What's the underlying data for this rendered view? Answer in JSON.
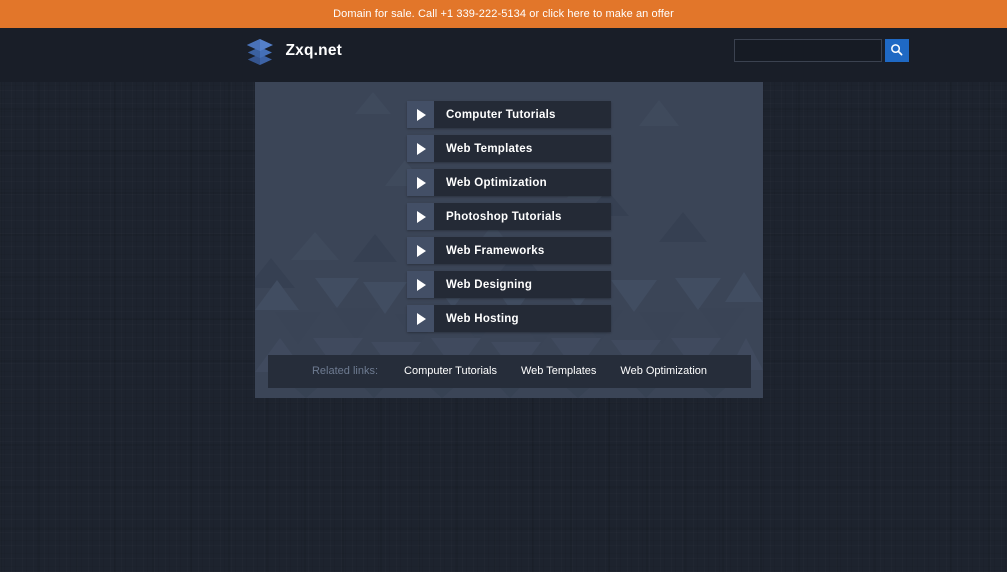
{
  "domain_bar": {
    "text": "Domain for sale. Call +1 339-222-5134 or click here to make an offer"
  },
  "header": {
    "brand_name": "Zxq.net",
    "logo_icon": "layers-stack-icon",
    "search": {
      "value": "",
      "placeholder": "",
      "button_icon": "search-icon"
    }
  },
  "main": {
    "menu_items": [
      {
        "label": "Computer Tutorials"
      },
      {
        "label": "Web Templates"
      },
      {
        "label": "Web Optimization"
      },
      {
        "label": "Photoshop Tutorials"
      },
      {
        "label": "Web Frameworks"
      },
      {
        "label": "Web Designing"
      },
      {
        "label": "Web Hosting"
      }
    ],
    "related": {
      "label": "Related links:",
      "links": [
        {
          "label": "Computer Tutorials"
        },
        {
          "label": "Web Templates"
        },
        {
          "label": "Web Optimization"
        }
      ]
    }
  },
  "colors": {
    "domain_bar_bg": "#e2762a",
    "header_bg": "#191e28",
    "page_bg": "#1d232e",
    "panel_bg": "#3b4557",
    "menu_arrow_bg": "#434f66",
    "menu_label_bg": "#242a36",
    "search_button_bg": "#1f69c4",
    "related_box_bg": "#262d3a",
    "related_label_color": "#6e7b91",
    "logo_blue": "#4a72b8"
  }
}
